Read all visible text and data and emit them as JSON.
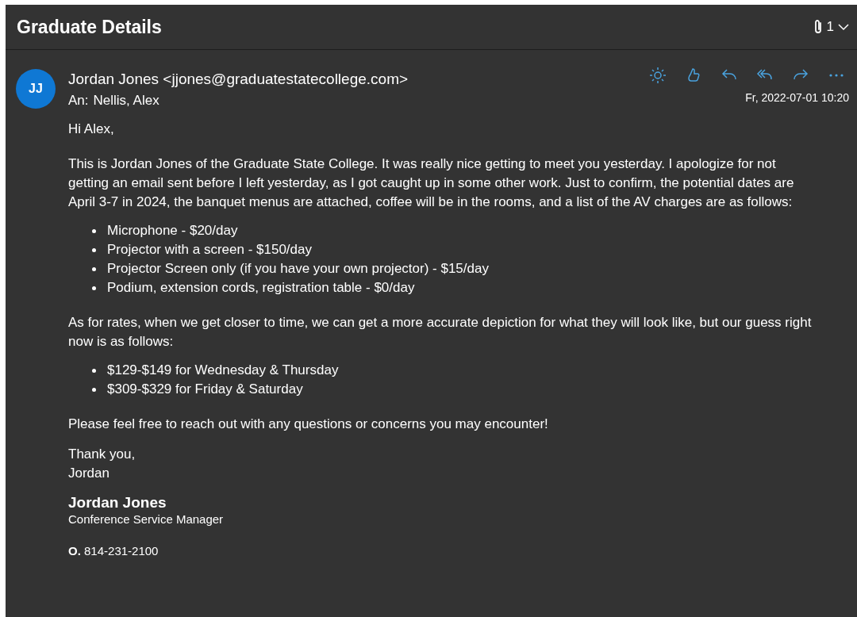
{
  "subject": "Graduate Details",
  "attachments": {
    "count": "1"
  },
  "message": {
    "avatar": "JJ",
    "from": "Jordan Jones <jjones@graduatestatecollege.com>",
    "to_label": "An:",
    "to": "Nellis, Alex",
    "date": "Fr, 2022-07-01 10:20",
    "actions": [
      {
        "kind": "sun"
      },
      {
        "kind": "like"
      },
      {
        "kind": "reply"
      },
      {
        "kind": "reply-all"
      },
      {
        "kind": "forward"
      },
      {
        "kind": "more"
      }
    ]
  },
  "body": [
    {
      "kind": "p",
      "text": "Hi Alex,"
    },
    {
      "kind": "p",
      "text": "This is Jordan Jones of the Graduate State College.  It was really nice getting to meet you yesterday.  I apologize for not getting an email sent before I left yesterday, as I got caught up in some other work.  Just to confirm, the potential dates are April 3-7 in 2024, the banquet menus are attached, coffee will be in the rooms, and a list of the AV charges are as follows:"
    },
    {
      "kind": "list",
      "items": [
        "Microphone - $20/day",
        "Projector with a screen - $150/day",
        "Projector Screen only (if you have your own projector) - $15/day",
        "Podium, extension cords, registration table - $0/day"
      ]
    },
    {
      "kind": "p",
      "text": "As for rates, when we get closer to time, we can get a more accurate depiction for what they will look like, but our guess right now is as follows:"
    },
    {
      "kind": "list",
      "items": [
        "$129-$149 for Wednesday & Thursday",
        "$309-$329 for Friday & Saturday"
      ]
    },
    {
      "kind": "p",
      "text": "Please feel free to reach out with any questions or concerns you may encounter!"
    },
    {
      "kind": "closing",
      "lines": [
        "Thank you,",
        "Jordan"
      ]
    }
  ],
  "signature": {
    "name": "Jordan Jones",
    "title": "Conference Service Manager",
    "phone": "**O.** 814-231-2100"
  }
}
